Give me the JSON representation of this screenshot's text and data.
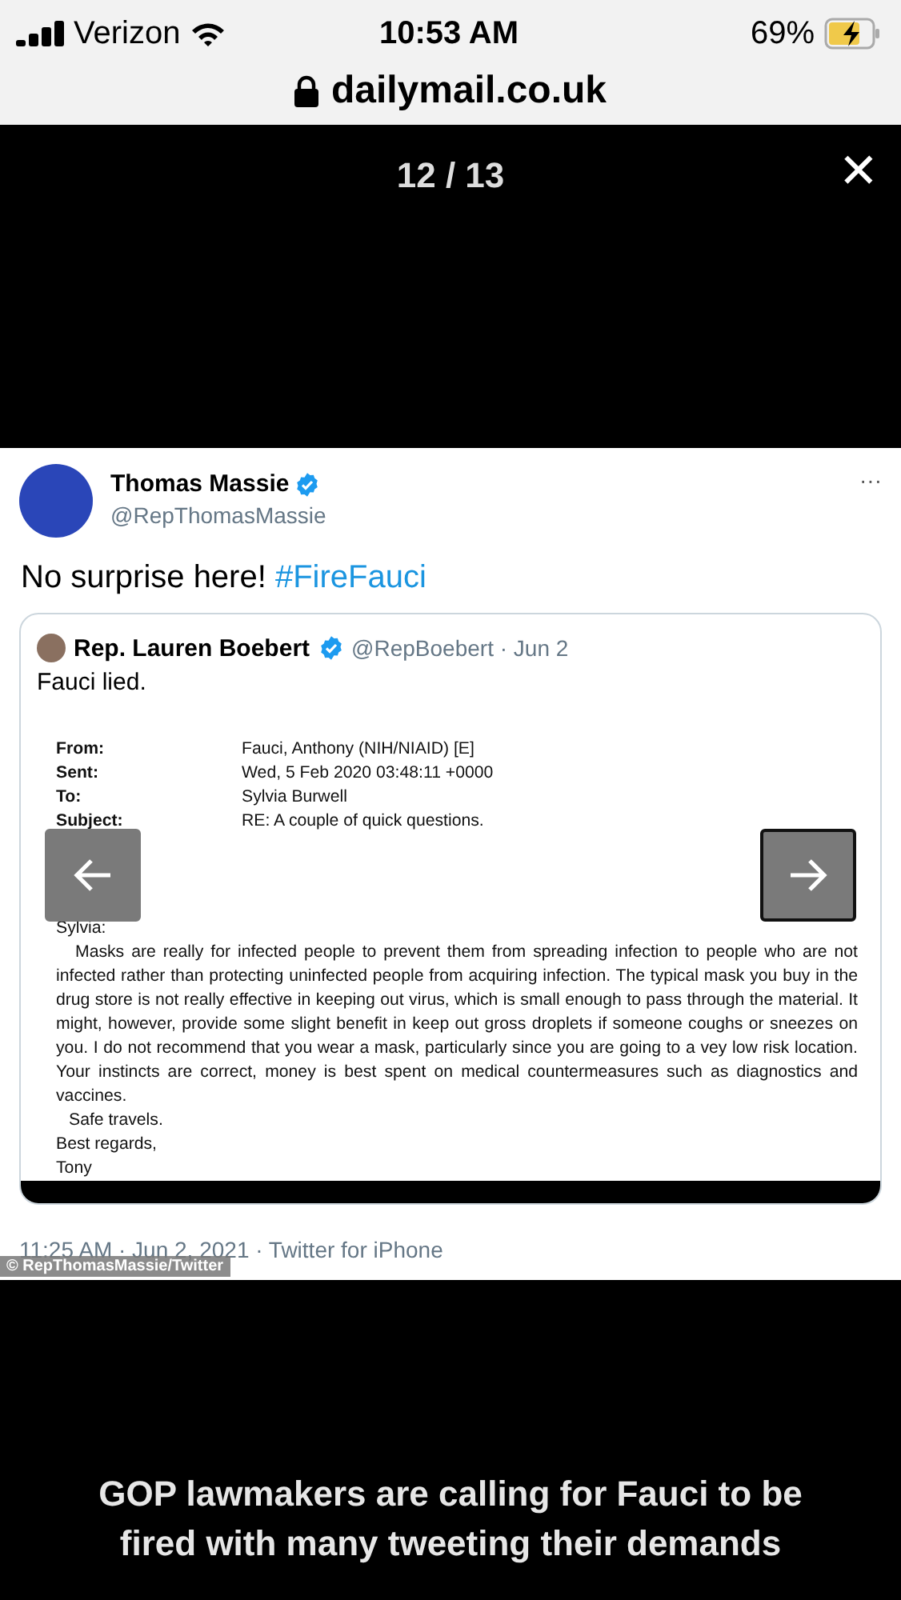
{
  "status_bar": {
    "carrier": "Verizon",
    "time": "10:53 AM",
    "battery": "69%",
    "charging": true
  },
  "address_bar": {
    "url": "dailymail.co.uk"
  },
  "gallery": {
    "counter": "12 / 13",
    "close": "✕",
    "credit": "© RepThomasMassie/Twitter",
    "caption": "GOP lawmakers are calling for Fauci to be fired with many tweeting their demands"
  },
  "tweet": {
    "name": "Thomas Massie",
    "verified": true,
    "handle": "@RepThomasMassie",
    "text": "No surprise here! ",
    "hashtag": "#FireFauci",
    "more": "···",
    "quote": {
      "name": "Rep. Lauren Boebert",
      "verified": true,
      "handle": "@RepBoebert · Jun 2",
      "text": "Fauci lied.",
      "email": {
        "headers": [
          {
            "label": "From:",
            "value": "Fauci, Anthony (NIH/NIAID) [E]"
          },
          {
            "label": "Sent:",
            "value": "Wed, 5 Feb 2020 03:48:11 +0000"
          },
          {
            "label": "To:",
            "value": "Sylvia Burwell"
          },
          {
            "label": "Subject:",
            "value": "RE: A couple of quick questions."
          }
        ],
        "greeting": "Sylvia:",
        "body": "Masks are really for infected people to prevent them from spreading infection to people who are not infected rather than protecting uninfected people from acquiring infection.   The typical mask you buy in the drug store is not really effective in keeping out virus, which is small enough to pass through the material.   It might, however, provide some slight benefit in keep out gross droplets if someone coughs or sneezes on you.  I do not recommend that you wear a mask, particularly since you are going to a vey low risk location.   Your instincts are correct, money is best spent on medical countermeasures such as diagnostics and vaccines.",
        "closing": [
          "Safe travels.",
          "Best regards,",
          "Tony"
        ]
      }
    },
    "timestamp": "11:25 AM · Jun 2, 2021 · Twitter for iPhone"
  }
}
